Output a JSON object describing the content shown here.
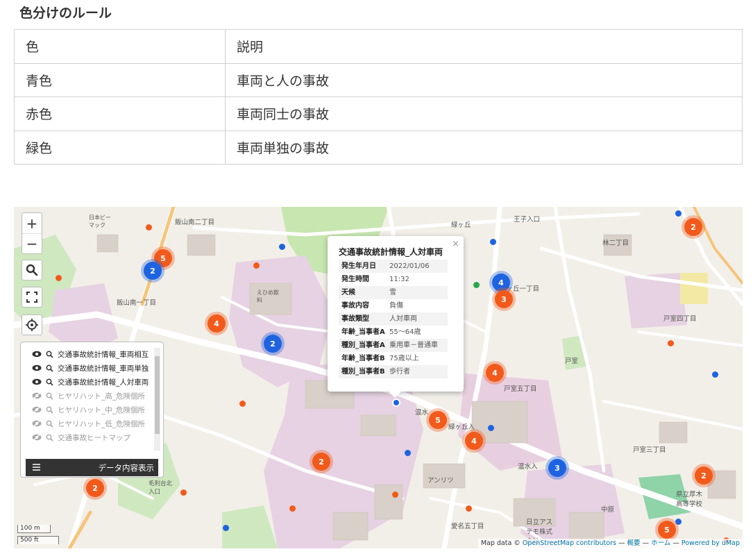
{
  "heading": "色分けのルール",
  "rules_table": {
    "header": [
      "色",
      "説明"
    ],
    "rows": [
      [
        "青色",
        "車両と人の事故"
      ],
      [
        "赤色",
        "車両同士の事故"
      ],
      [
        "緑色",
        "車両単独の事故"
      ]
    ]
  },
  "map": {
    "colors": {
      "red_marker": "#f25a1b",
      "blue_marker": "#1e63e0",
      "green_marker": "#2aa84a"
    },
    "zoom_in": "+",
    "zoom_out": "−",
    "controls": [
      "search-icon",
      "fullscreen-icon",
      "locate-icon"
    ],
    "layers": [
      {
        "label": "交通事故統計情報_車両相互",
        "visible": true
      },
      {
        "label": "交通事故統計情報_車両単独",
        "visible": true
      },
      {
        "label": "交通事故統計情報_人対車両",
        "visible": true
      },
      {
        "label": "ヒヤリハット_高_危険個所",
        "visible": false
      },
      {
        "label": "ヒヤリハット_中_危険個所",
        "visible": false
      },
      {
        "label": "ヒヤリハット_低_危険個所",
        "visible": false
      },
      {
        "label": "交通事故ヒートマップ",
        "visible": false
      }
    ],
    "show_data_button": "データ内容表示",
    "popup": {
      "title": "交通事故統計情報_人対車両",
      "close": "×",
      "rows": [
        {
          "k": "発生年月日",
          "v": "2022/01/06"
        },
        {
          "k": "発生時間",
          "v": "11:32"
        },
        {
          "k": "天候",
          "v": "雪"
        },
        {
          "k": "事故内容",
          "v": "負傷"
        },
        {
          "k": "事故類型",
          "v": "人対車両"
        },
        {
          "k": "年齢_当事者A",
          "v": "55〜64歳"
        },
        {
          "k": "種別_当事者A",
          "v": "乗用車－普通車"
        },
        {
          "k": "年齢_当事者B",
          "v": "75歳以上"
        },
        {
          "k": "種別_当事者B",
          "v": "歩行者"
        }
      ]
    },
    "clusters": [
      {
        "count": "5",
        "color": "orange"
      },
      {
        "count": "2",
        "color": "blue"
      },
      {
        "count": "4",
        "color": "orange"
      },
      {
        "count": "2",
        "color": "blue"
      },
      {
        "count": "2",
        "color": "orange"
      },
      {
        "count": "2",
        "color": "orange"
      },
      {
        "count": "4",
        "color": "blue"
      },
      {
        "count": "3",
        "color": "orange"
      },
      {
        "count": "4",
        "color": "orange"
      },
      {
        "count": "5",
        "color": "orange"
      },
      {
        "count": "4",
        "color": "orange"
      },
      {
        "count": "3",
        "color": "blue"
      },
      {
        "count": "2",
        "color": "orange"
      },
      {
        "count": "2",
        "color": "orange"
      },
      {
        "count": "5",
        "color": "orange"
      }
    ],
    "place_labels": [
      "飯山南二丁目",
      "飯山南一丁目",
      "日本ビー\nマック",
      "えひめ飲\n料",
      "緑ヶ丘",
      "緑ヶ丘一丁目",
      "林二丁目",
      "王子入口",
      "戸室四丁目",
      "戸室五丁目",
      "戸室",
      "戸室三丁目",
      "緑ヶ丘入",
      "温水入",
      "アンリツ",
      "温水",
      "愛名五丁目",
      "日立アス\nテモ株式\n会社",
      "県立厚木\n高等学校",
      "毛利台北\n入口",
      "中原"
    ],
    "scale": {
      "metric": "100 m",
      "imperial": "500 ft"
    },
    "attribution": {
      "prefix": "Map data ©",
      "osm": "OpenStreetMap contributors",
      "sep1": "—",
      "overview": "概要",
      "sep2": "—",
      "home": "ホーム",
      "sep3": "—",
      "powered": "Powered by uMap"
    }
  }
}
